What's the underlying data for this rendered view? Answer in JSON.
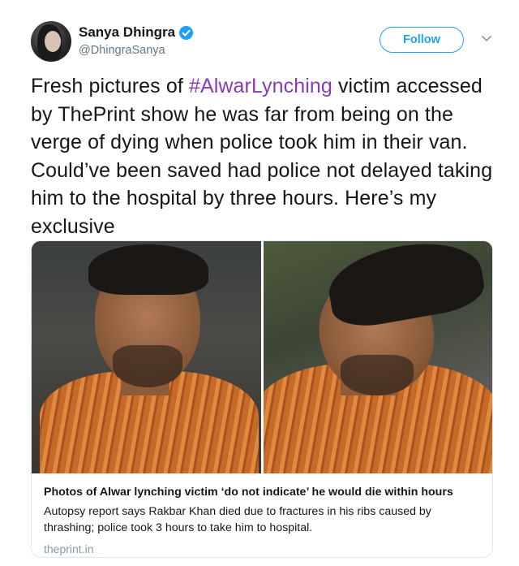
{
  "user": {
    "display_name": "Sanya Dhingra",
    "handle": "@DhingraSanya",
    "verified_icon": "verified-badge-icon"
  },
  "actions": {
    "follow_label": "Follow",
    "more_icon": "chevron-down-icon"
  },
  "tweet": {
    "text_before": "Fresh pictures of ",
    "hashtag": "#AlwarLynching",
    "text_after": " victim accessed by ThePrint show he was far from being on the verge of dying when police took him in their van. Could’ve been saved had police not delayed taking him to the hospital by three hours. Here’s my exclusive"
  },
  "card": {
    "title": "Photos of Alwar lynching victim ‘do not indicate’ he would die within hours",
    "description": "Autopsy report says Rakbar Khan died due to fractures in his ribs caused by thrashing; police took 3 hours to take him to hospital.",
    "domain": "theprint.in"
  },
  "colors": {
    "accent": "#1da1f2",
    "hashtag": "#8a3ab9",
    "muted": "#657786"
  }
}
